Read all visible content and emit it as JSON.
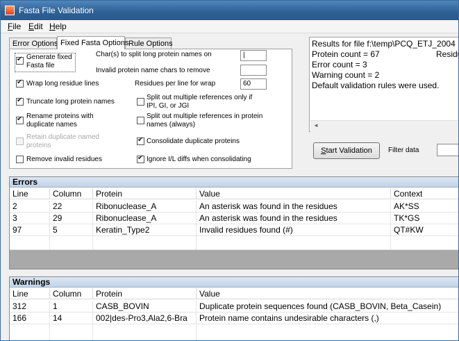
{
  "window": {
    "title": "Fasta File Validation"
  },
  "menu": [
    {
      "key": "F",
      "rest": "ile"
    },
    {
      "key": "E",
      "rest": "dit"
    },
    {
      "key": "H",
      "rest": "elp"
    }
  ],
  "tabs": [
    "Error Options",
    "Fixed Fasta Options",
    "Rule Options"
  ],
  "fixed_options": {
    "generate_fixed": {
      "label": "Generate fixed Fasta file",
      "checked": true
    },
    "split_chars_label": "Char(s) to split long protein names on",
    "split_chars_value": "|",
    "invalid_chars_label": "Invalid protein name chars to remove",
    "invalid_chars_value": "",
    "wrap_long": {
      "label": "Wrap long residue lines",
      "checked": true
    },
    "residues_per_line_label": "Residues per line for wrap",
    "residues_per_line_value": "60",
    "truncate": {
      "label": "Truncate long protein names",
      "checked": true
    },
    "split_refs_ipi": {
      "label": "Split out multiple references only if IPI, GI, or JGI",
      "checked": false
    },
    "rename_dups": {
      "label": "Rename proteins with duplicate names",
      "checked": true
    },
    "split_refs_always": {
      "label": "Split out multiple references in protein names (always)",
      "checked": false
    },
    "retain_dups": {
      "label": "Retain duplicate named proteins",
      "checked": false,
      "disabled": true
    },
    "consolidate": {
      "label": "Consolidate duplicate proteins",
      "checked": true
    },
    "remove_invalid": {
      "label": "Remove invalid residues",
      "checked": false
    },
    "ignore_il": {
      "label": "Ignore I/L diffs when consolidating",
      "checked": true
    }
  },
  "results": {
    "lines": [
      "Results for file f:\\temp\\PCQ_ETJ_2004",
      "Protein count = 67",
      "Error count = 3",
      "Warning count = 2",
      "Default validation rules were used."
    ],
    "residue_cut": "Residu"
  },
  "actions": {
    "start_validation_key": "S",
    "start_validation_rest": "tart Validation",
    "filter_label": "Filter data",
    "filter_value": ""
  },
  "errors": {
    "title": "Errors",
    "columns": [
      "Line",
      "Column",
      "Protein",
      "Value",
      "Context"
    ],
    "rows": [
      [
        "2",
        "22",
        "Ribonuclease_A",
        "An asterisk was found in the residues",
        "AK*SS"
      ],
      [
        "3",
        "29",
        "Ribonuclease_A",
        "An asterisk was found in the residues",
        "TK*GS"
      ],
      [
        "97",
        "5",
        "Keratin_Type2",
        "Invalid residues found (#)",
        "QT#KW"
      ]
    ]
  },
  "warnings": {
    "title": "Warnings",
    "columns": [
      "Line",
      "Column",
      "Protein",
      "Value"
    ],
    "rows": [
      [
        "312",
        "1",
        "CASB_BOVIN",
        "Duplicate protein sequences found (CASB_BOVIN, Beta_Casein)"
      ],
      [
        "166",
        "14",
        "002|des-Pro3,Ala2,6-Bra",
        "Protein name contains undesirable characters (,)"
      ]
    ]
  }
}
